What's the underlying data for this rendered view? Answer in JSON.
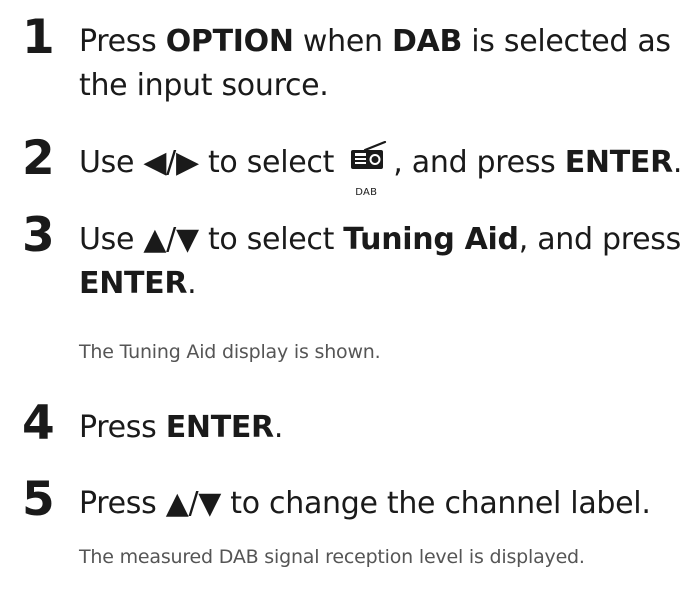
{
  "steps": [
    {
      "number": "1",
      "parts": [
        {
          "t": "Press ",
          "b": false
        },
        {
          "t": "OPTION",
          "b": true
        },
        {
          "t": " when ",
          "b": false
        },
        {
          "t": "DAB",
          "b": true
        },
        {
          "t": " is selected as the input source.",
          "b": false
        }
      ]
    },
    {
      "number": "2",
      "text_before_icon": "Use ◀/▶ to select ",
      "icon": "radio-icon",
      "icon_label": "DAB",
      "text_after_icon": ", and press ",
      "bold_end": "ENTER",
      "period": "."
    },
    {
      "number": "3",
      "parts": [
        {
          "t": "Use ▲/▼ to select ",
          "b": false
        },
        {
          "t": "Tuning Aid",
          "b": true
        },
        {
          "t": ", and press ",
          "b": false
        },
        {
          "t": "ENTER",
          "b": true
        },
        {
          "t": ".",
          "b": false
        }
      ],
      "note": "The Tuning Aid display is shown."
    },
    {
      "number": "4",
      "parts": [
        {
          "t": "Press ",
          "b": false
        },
        {
          "t": "ENTER",
          "b": true
        },
        {
          "t": ".",
          "b": false
        }
      ]
    },
    {
      "number": "5",
      "parts": [
        {
          "t": "Press ▲/▼ to change the channel label.",
          "b": false
        }
      ],
      "note": "The measured DAB signal reception level is displayed."
    }
  ]
}
